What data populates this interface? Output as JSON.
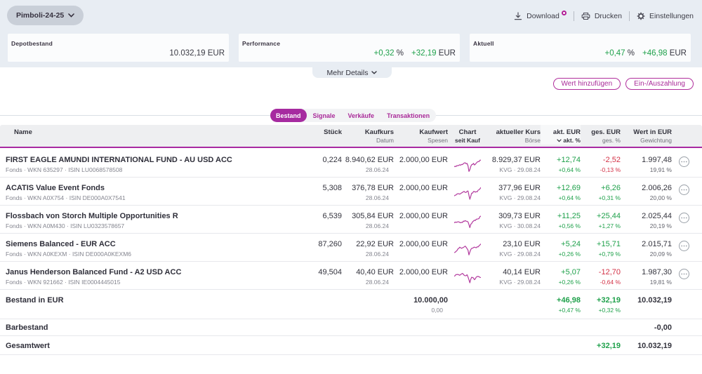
{
  "colors": {
    "brand_magenta": "#a62ba0",
    "positive_green": "#1fa14b",
    "negative_red": "#d33146",
    "topbar_bg": "#e8edf3",
    "header_row_bg": "#eeeff1"
  },
  "topbar": {
    "depot_name": "Pimboli-24-25",
    "actions": {
      "download": "Download",
      "print": "Drucken",
      "settings": "Einstellungen"
    }
  },
  "cards": {
    "depotbestand": {
      "label": "Depotbestand",
      "value": "10.032,19 EUR"
    },
    "performance": {
      "label": "Performance",
      "percent": "+0,32",
      "percent_unit": " %",
      "amount": "+32,19",
      "amount_unit": " EUR"
    },
    "aktuell": {
      "label": "Aktuell",
      "percent": "+0,47",
      "percent_unit": " %",
      "amount": "+46,98",
      "amount_unit": " EUR"
    }
  },
  "mehr_details_label": "Mehr Details",
  "buttons": {
    "add_value": "Wert hinzufügen",
    "deposit_withdraw": "Ein-/Auszahlung"
  },
  "tabs": [
    {
      "label": "Bestand",
      "active": true
    },
    {
      "label": "Signale",
      "active": false
    },
    {
      "label": "Verkäufe",
      "active": false
    },
    {
      "label": "Transaktionen",
      "active": false
    }
  ],
  "table": {
    "header": {
      "name": "Name",
      "stueck": "Stück",
      "kaufkurs": "Kaufkurs",
      "kaufkurs_sub": "Datum",
      "kaufwert": "Kaufwert",
      "kaufwert_sub": "Spesen",
      "chart": "Chart",
      "chart_sub": "seit Kauf",
      "kurs": "aktueller Kurs",
      "kurs_sub": "Börse",
      "akt": "akt. EUR",
      "akt_sub": "akt. %",
      "ges": "ges. EUR",
      "ges_sub": "ges. %",
      "wert": "Wert in EUR",
      "wert_sub": "Gewichtung"
    },
    "rows": [
      {
        "name": "FIRST EAGLE AMUNDI INTERNATIONAL FUND - AU USD ACC",
        "sub": "Fonds · WKN 635297 · ISIN LU0068578508",
        "stueck": "0,224",
        "kaufkurs": "8.940,62 EUR",
        "kaufdatum": "28.06.24",
        "kaufwert": "2.000,00 EUR",
        "spark": "0.0,15.7 1.3,14.9 2.6,15.4 3.9,13.9 5.2,14.2 6.6,13.6 7.9,12.8 9.2,13.4 10.5,12.3 11.8,12.6 13.1,11.1 14.4,10.3 15.7,10.0 17.0,11.3 18.3,10.9 19.7,14.4 21.0,22.3 22.3,19.8 23.6,15.2 24.9,12.7 26.2,12.3 27.5,10.8 28.8,13.1 30.1,12.1 31.4,10.5 32.8,9.0 34.1,8.2 35.4,8.3 36.7,6.3 38.0,6.1",
        "kurs": "8.929,37 EUR",
        "kurs_sub": "KVG · 29.08.24",
        "akt_eur": "+12,74",
        "akt_pct": "+0,64 %",
        "ges_eur": "-2,52",
        "ges_pct": "-0,13 %",
        "ges_negative": true,
        "wert": "1.997,48",
        "gewichtung": "19,91 %"
      },
      {
        "name": "ACATIS Value Event Fonds",
        "sub": "Fonds · WKN A0X754 · ISIN DE000A0X7541",
        "stueck": "5,308",
        "kaufkurs": "376,78 EUR",
        "kaufdatum": "28.06.24",
        "kaufwert": "2.000,00 EUR",
        "spark": "0.0,17.3 1.3,16.2 2.6,15.9 3.9,14.5 5.2,14.1 6.6,14.1 7.9,14.7 9.2,13.9 10.5,12.9 11.8,12.3 13.1,11.1 14.4,10.9 15.7,12.2 17.0,12.3 18.3,10.6 19.7,10.2 21.0,16.4 22.3,22.0 23.6,17.8 24.9,13.2 26.2,13.2 27.5,10.9 28.8,10.9 30.1,11.9 31.4,11.1 32.8,11.4 34.1,9.0 35.4,8.5 36.7,7.1 38.0,5.1",
        "kurs": "377,96 EUR",
        "kurs_sub": "KVG · 29.08.24",
        "akt_eur": "+12,69",
        "akt_pct": "+0,64 %",
        "ges_eur": "+6,26",
        "ges_pct": "+0,31 %",
        "ges_negative": false,
        "wert": "2.006,26",
        "gewichtung": "20,00 %"
      },
      {
        "name": "Flossbach von Storch Multiple Opportunities R",
        "sub": "Fonds · WKN A0M430 · ISIN LU0323578657",
        "stueck": "6,539",
        "kaufkurs": "305,84 EUR",
        "kaufdatum": "28.06.24",
        "kaufwert": "2.000,00 EUR",
        "spark": "0.0,15.7 1.3,14.4 2.6,14.9 3.9,14.5 5.2,14.2 6.6,14.1 7.9,15.0 9.2,15.4 10.5,14.8 11.8,15.0 13.1,13.1 14.4,13.4 15.7,12.4 17.0,13.2 18.3,13.4 19.7,14.3 21.0,18.0 22.3,22.4 23.6,17.7 24.9,16.4 26.2,14.1 27.5,13.0 28.8,11.8 30.1,12.3 31.4,10.5 32.8,10.2 34.1,9.9 35.4,9.4 36.7,6.6 38.0,5.9",
        "kurs": "309,73 EUR",
        "kurs_sub": "KVG · 30.08.24",
        "akt_eur": "+11,25",
        "akt_pct": "+0,56 %",
        "ges_eur": "+25,44",
        "ges_pct": "+1,27 %",
        "ges_negative": false,
        "wert": "2.025,44",
        "gewichtung": "20,19 %"
      },
      {
        "name": "Siemens Balanced - EUR ACC",
        "sub": "Fonds · WKN A0KEXM · ISIN DE000A0KEXM6",
        "stueck": "87,260",
        "kaufkurs": "22,92 EUR",
        "kaufdatum": "28.06.24",
        "kaufwert": "2.000,00 EUR",
        "spark": "0.0,18.1 1.3,17.5 2.6,16.3 3.9,15.2 5.2,12.9 6.6,11.8 7.9,10.3 9.2,11.1 10.5,11.9 11.8,11.2 13.1,10.7 14.4,9.7 15.7,8.7 17.0,10.4 18.3,12.3 19.7,14.6 21.0,21.3 22.3,17.2 23.6,13.7 24.9,11.8 26.2,11.8 27.5,10.7 28.8,10.2 30.1,10.7 31.4,11.1 32.8,9.7 34.1,9.9 35.4,8.3 36.7,7.1 38.0,5.5",
        "kurs": "23,10 EUR",
        "kurs_sub": "KVG · 29.08.24",
        "akt_eur": "+5,24",
        "akt_pct": "+0,26 %",
        "ges_eur": "+15,71",
        "ges_pct": "+0,79 %",
        "ges_negative": false,
        "wert": "2.015,71",
        "gewichtung": "20,09 %"
      },
      {
        "name": "Janus Henderson Balanced Fund - A2 USD ACC",
        "sub": "Fonds · WKN 921662 · ISIN IE0004445015",
        "stueck": "49,504",
        "kaufkurs": "40,40 EUR",
        "kaufdatum": "28.06.24",
        "kaufwert": "2.000,00 EUR",
        "spark": "0.0,11.8 1.3,10.8 2.6,9.2 3.9,9.3 5.2,9.0 6.6,9.7 7.9,10.3 9.2,9.2 10.5,8.4 11.8,7.6 13.1,8.9 14.4,10.5 15.7,11.0 17.0,10.8 18.3,9.5 19.7,12.8 21.0,16.7 22.3,21.0 23.6,16.0 24.9,13.1 26.2,13.6 27.5,14.2 28.8,16.6 30.1,15.4 31.4,12.9 32.8,12.1 34.1,11.9 35.4,12.4 36.7,13.3 38.0,13.6",
        "kurs": "40,14 EUR",
        "kurs_sub": "KVG · 29.08.24",
        "akt_eur": "+5,07",
        "akt_pct": "+0,26 %",
        "ges_eur": "-12,70",
        "ges_pct": "-0,64 %",
        "ges_negative": true,
        "wert": "1.987,30",
        "gewichtung": "19,81 %"
      }
    ],
    "summary": {
      "bestand": {
        "label": "Bestand in EUR",
        "kaufwert": "10.000,00",
        "kaufwert_sub": "0,00",
        "akt_eur": "+46,98",
        "akt_pct": "+0,47 %",
        "ges_eur": "+32,19",
        "ges_pct": "+0,32 %",
        "wert": "10.032,19"
      },
      "barbestand": {
        "label": "Barbestand",
        "wert": "-0,00"
      },
      "gesamtwert": {
        "label": "Gesamtwert",
        "ges_eur": "+32,19",
        "wert": "10.032,19"
      }
    }
  }
}
